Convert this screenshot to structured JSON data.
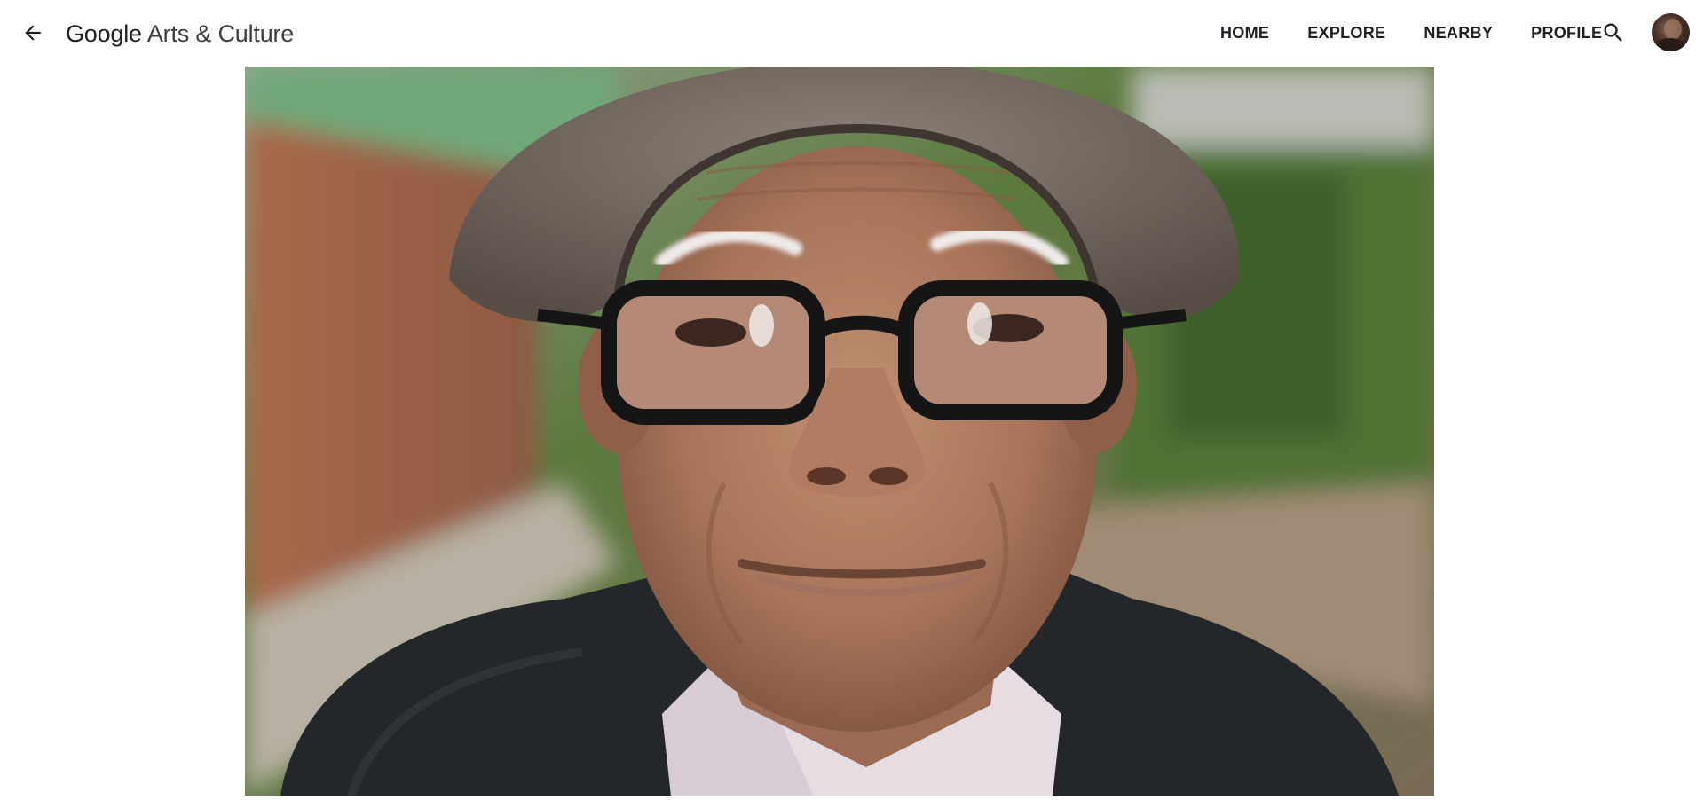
{
  "header": {
    "logo_google": "Google",
    "logo_rest": "Arts & Culture",
    "nav": [
      {
        "label": "HOME"
      },
      {
        "label": "EXPLORE"
      },
      {
        "label": "NEARBY"
      },
      {
        "label": "PROFILE"
      }
    ],
    "icons": {
      "back": "arrow-back-icon",
      "search": "search-icon",
      "avatar": "user-avatar"
    }
  },
  "main": {
    "image": {
      "subject": "portrait photograph"
    }
  },
  "colors": {
    "text": "#202124",
    "background": "#ffffff"
  }
}
